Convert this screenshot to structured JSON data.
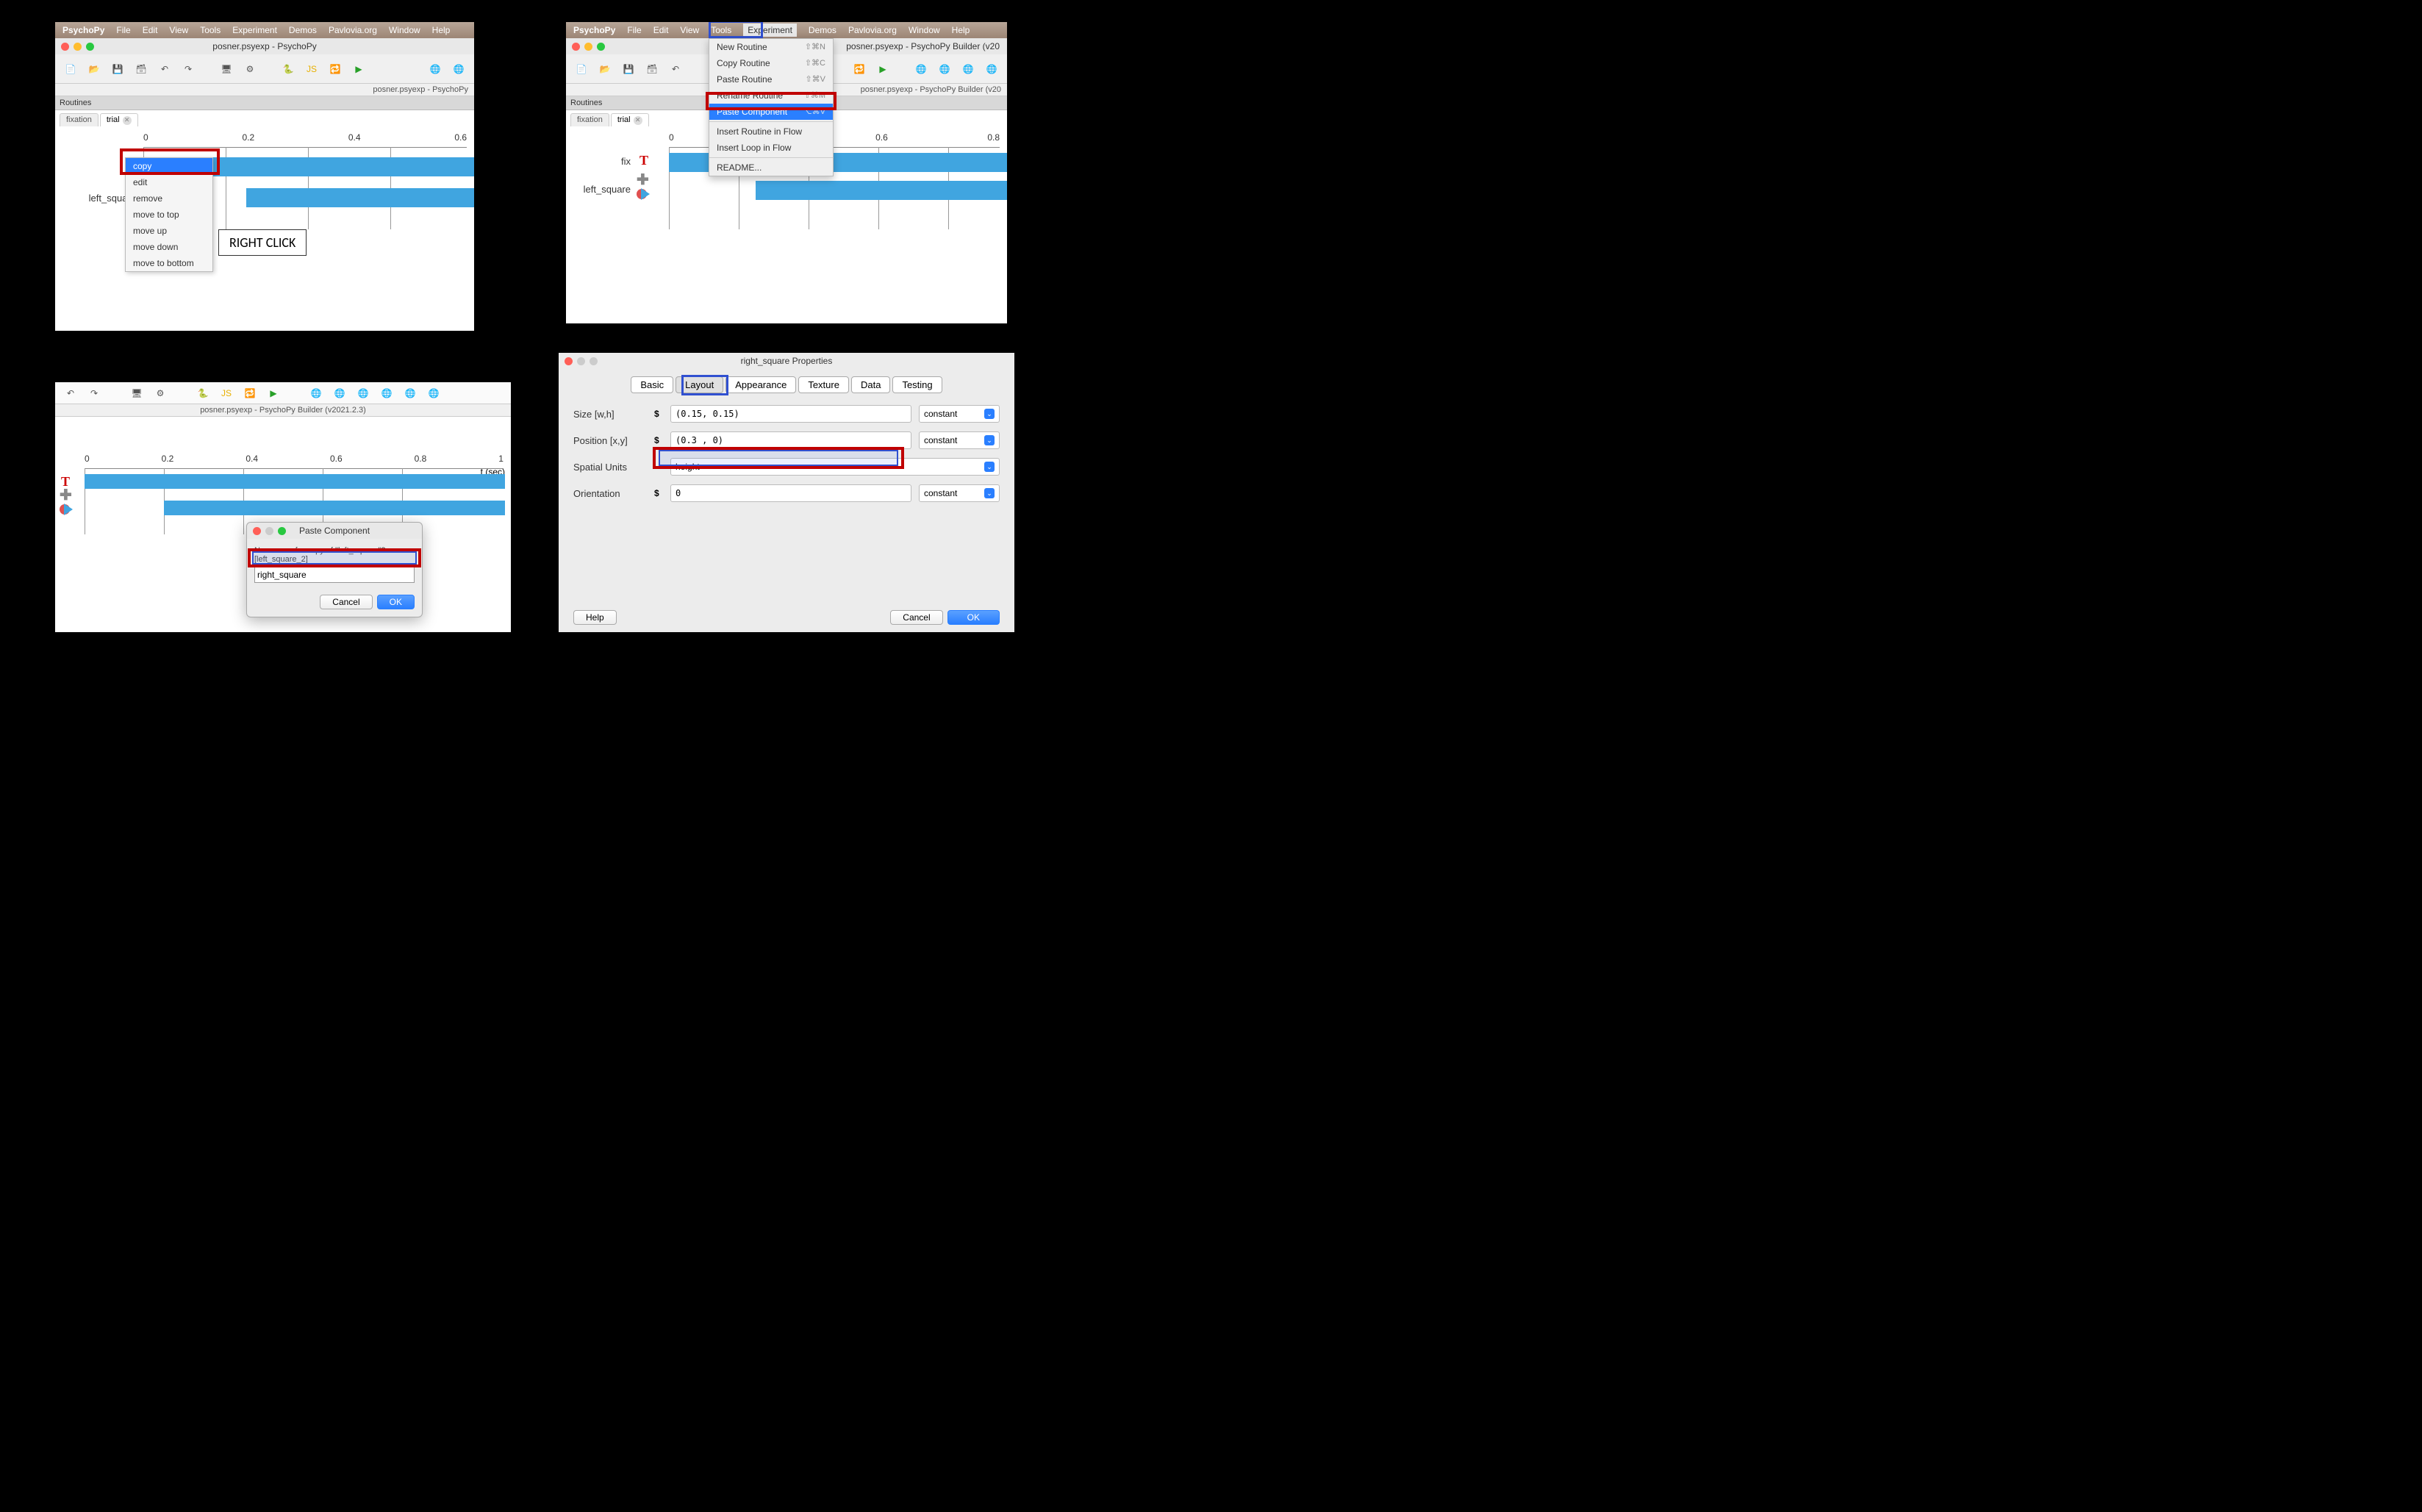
{
  "menubar": {
    "app": "PsychoPy",
    "items": [
      "File",
      "Edit",
      "View",
      "Tools",
      "Experiment",
      "Demos",
      "Pavlovia.org",
      "Window",
      "Help"
    ]
  },
  "window": {
    "title": "posner.psyexp - PsychoPy",
    "subtitle": "posner.psyexp - PsychoPy",
    "subtitle_full": "posner.psyexp - PsychoPy Builder (v20",
    "subtitle3": "posner.psyexp - PsychoPy Builder (v2021.2.3)"
  },
  "routines_label": "Routines",
  "tabs": {
    "fixation": "fixation",
    "trial": "trial"
  },
  "timeline1": {
    "ticks": [
      "0",
      "0.2",
      "0.4",
      "0.6"
    ],
    "rows": {
      "fix": "fix",
      "left_square": "left_square"
    }
  },
  "context_menu": {
    "items": [
      "copy",
      "edit",
      "remove",
      "move to top",
      "move up",
      "move down",
      "move to bottom"
    ],
    "selected": "copy"
  },
  "callout": "RIGHT CLICK",
  "exp_menu": {
    "items": [
      {
        "label": "New Routine",
        "sc": "⇧⌘N"
      },
      {
        "label": "Copy Routine",
        "sc": "⇧⌘C"
      },
      {
        "label": "Paste Routine",
        "sc": "⇧⌘V"
      },
      {
        "label": "Rename Routine",
        "sc": "⇧⌘M"
      },
      {
        "label": "Paste Component",
        "sc": "⌥⌘V",
        "sel": true
      },
      {
        "label": "Insert Routine in Flow"
      },
      {
        "label": "Insert Loop in Flow"
      },
      {
        "label": "README..."
      }
    ]
  },
  "timeline2": {
    "ticks": [
      "0.6",
      "0.8"
    ],
    "rows": {
      "fix": "fix",
      "left_square": "left_square"
    }
  },
  "timeline3": {
    "ticks": [
      "0",
      "0.2",
      "0.4",
      "0.6",
      "0.8",
      "1"
    ],
    "xlabel": "t (sec)"
  },
  "paste_dialog": {
    "title": "Paste Component",
    "prompt": "New name for copy of \"left_square\"?  [left_square_2]",
    "value": "right_square",
    "cancel": "Cancel",
    "ok": "OK"
  },
  "props": {
    "title": "right_square Properties",
    "tabs": [
      "Basic",
      "Layout",
      "Appearance",
      "Texture",
      "Data",
      "Testing"
    ],
    "active_tab": "Layout",
    "size": {
      "label": "Size [w,h]",
      "value": "(0.15, 0.15)",
      "mode": "constant"
    },
    "position": {
      "label": "Position [x,y]",
      "value": "(0.3 , 0)",
      "mode": "constant"
    },
    "units": {
      "label": "Spatial Units",
      "value": "height"
    },
    "orientation": {
      "label": "Orientation",
      "value": "0",
      "mode": "constant"
    },
    "help": "Help",
    "cancel": "Cancel",
    "ok": "OK"
  },
  "toolbar_icons": [
    "new",
    "open",
    "save",
    "save-as",
    "undo",
    "redo",
    "monitor",
    "settings",
    "py",
    "js",
    "compile",
    "run",
    "globe1",
    "globe2",
    "globe3",
    "globe4"
  ]
}
